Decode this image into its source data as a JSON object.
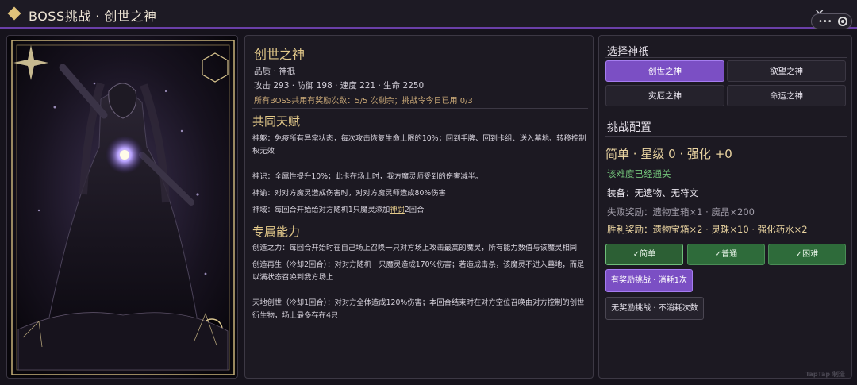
{
  "header": {
    "title": "BOSS挑战 · 创世之神",
    "close_icon": "×"
  },
  "god": {
    "name": "创世之神",
    "quality": "品质 · 神祇",
    "stats": "攻击 293 · 防御 198 · 速度 221 · 生命 2250",
    "reward_note": "所有BOSS共用有奖励次数：5/5 次剩余；挑战令今日已用 0/3"
  },
  "talents": {
    "title": "共同天赋",
    "items": [
      "神躯：免疫所有异常状态，每次攻击恢复生命上限的10%；回到手牌、回到卡组、送入墓地、转移控制权无效",
      "神识：全属性提升10%；此卡在场上时，我方魔灵师受到的伤害减半。",
      "神谕：对对方魔灵造成伤害时，对对方魔灵师造成80%伤害",
      "神域：每回合开始给对方随机1只魔灵添加",
      "神罚",
      "2回合"
    ]
  },
  "abilities": {
    "title": "专属能力",
    "items": [
      "创造之力：每回合开始时在自己场上召唤一只对方场上攻击最高的魔灵，所有能力数值与该魔灵相同",
      "创造再生（冷却2回合）：对对方随机一只魔灵造成170%伤害；若造成击杀，该魔灵不进入墓地，而是以满状态召唤到我方场上",
      "天地创世（冷却1回合）：对对方全体造成120%伤害；本回合结束时在对方空位召唤由对方控制的创世衍生物，场上最多存在4只"
    ]
  },
  "select_god": {
    "title": "选择神祇",
    "options": [
      "创世之神",
      "欲望之神",
      "灾厄之神",
      "命运之神"
    ],
    "selected": "创世之神"
  },
  "config": {
    "title": "挑战配置",
    "difficulty_line": "简单 · 星级 0 · 强化 +0",
    "cleared": "该难度已经通关",
    "equipment": "装备：无遗物、无符文",
    "fail_reward": "失败奖励：遗物宝箱×1 · 魔晶×200",
    "win_reward": "胜利奖励：遗物宝箱×2 · 灵珠×10 · 强化药水×2",
    "difficulties": [
      "✓简单",
      "✓普通",
      "✓困难"
    ],
    "reward_button": "有奖励挑战 · 消耗1次",
    "noreward_button": "无奖励挑战 · 不消耗次数"
  },
  "watermark": "TapTap 制造",
  "colors": {
    "accent": "#7b4fc4",
    "gold": "#e3c98a",
    "green": "#2e6b3a",
    "cleared": "#73c47a"
  }
}
